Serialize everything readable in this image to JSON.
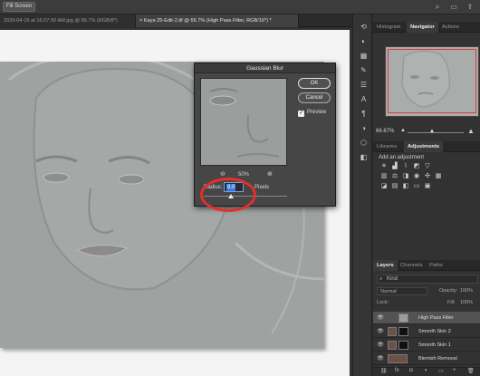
{
  "options_bar": {
    "fill_screen_label": "Fill Screen",
    "icons": [
      "search-icon",
      "workspace-icon",
      "share-icon"
    ]
  },
  "tabs": [
    {
      "label": "2020-04-16 at 16.07.50 AM.jpg @ 66.7% (RGB/8*)"
    },
    {
      "label": "× Kaya 25-Edit-2.tif @ 66.7% (High Pass Filter, RGB/16*) *"
    }
  ],
  "panels": {
    "top_tabs": [
      "Histogram",
      "Navigator",
      "Actions"
    ],
    "active_top_tab": "Navigator",
    "zoom_level": "66.67%",
    "mid_tabs": [
      "Libraries",
      "Adjustments"
    ],
    "active_mid_tab": "Adjustments",
    "add_adjustment": "Add an adjustment",
    "layers_tabs": [
      "Layers",
      "Channels",
      "Paths"
    ],
    "active_layers_tab": "Layers",
    "kind_label": "Kind",
    "blend_mode": "Normal",
    "opacity_label": "Opacity:",
    "opacity_value": "100%",
    "lock_label": "Lock:",
    "fill_label": "Fill:",
    "fill_value": "100%",
    "layers": [
      {
        "name": "High Pass Filter",
        "selected": true
      },
      {
        "name": "Smooth Skin 2",
        "selected": false
      },
      {
        "name": "Smooth Skin 1",
        "selected": false
      },
      {
        "name": "Blemish Removal",
        "selected": false
      }
    ]
  },
  "dialog": {
    "title": "Gaussian Blur",
    "ok_label": "OK",
    "cancel_label": "Cancel",
    "preview_label": "Preview",
    "preview_checked": true,
    "zoom_value": "50%",
    "radius_label": "Radius:",
    "radius_value": "8.0",
    "radius_unit": "Pixels",
    "slider_fraction": 0.33
  },
  "colors": {
    "accent": "#3b78d8",
    "highlight_ring": "#e3302a"
  }
}
